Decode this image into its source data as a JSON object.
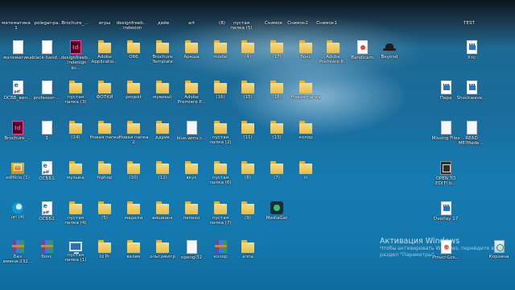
{
  "desktop": {
    "top_row_labels": [
      {
        "label": "математика 1",
        "type": "doc"
      },
      {
        "label": "polegar-pa...",
        "type": "doc"
      },
      {
        "label": "Brochure_...",
        "type": "doc"
      },
      {
        "label": "игры",
        "type": "folder"
      },
      {
        "label": "designfreeb... indesign 2-...",
        "type": "doc"
      },
      {
        "label": "дейв",
        "type": "folder"
      },
      {
        "label": "art",
        "type": "folder"
      },
      {
        "label": "(8)",
        "type": "folder"
      },
      {
        "label": "пустая папка (5)",
        "type": "folder"
      },
      {
        "label": "Снимок",
        "type": "doc"
      },
      {
        "label": "Снимок2",
        "type": "doc"
      },
      {
        "label": "Снимок1",
        "type": "doc"
      },
      {
        "label": "TEST",
        "type": "doc"
      }
    ],
    "icons": [
      {
        "label": "математика",
        "type": "doc"
      },
      {
        "label": "black-hand...",
        "type": "doc"
      },
      {
        "label": "designfreeb... indesign br...",
        "type": "indesign"
      },
      {
        "label": "Adobe Applicatio...",
        "type": "folder"
      },
      {
        "label": "Об6",
        "type": "folder"
      },
      {
        "label": "Brochure Template",
        "type": "folder"
      },
      {
        "label": "Аркша",
        "type": "folder"
      },
      {
        "label": "model",
        "type": "folder"
      },
      {
        "label": "(4)",
        "type": "folder"
      },
      {
        "label": "(17)",
        "type": "folder"
      },
      {
        "label": "бокс",
        "type": "folder"
      },
      {
        "label": "Adobe Premiere P...",
        "type": "folder"
      },
      {
        "label": "Bandicam",
        "type": "record"
      },
      {
        "label": "Beyond",
        "type": "hat"
      },
      {
        "label": "Хтс",
        "type": "video"
      },
      {
        "label": "ОСББ_вип...",
        "type": "pdf"
      },
      {
        "label": "professor-...",
        "type": "doc"
      },
      {
        "label": "пустая папка (3)",
        "type": "folder"
      },
      {
        "label": "ФОТКИ",
        "type": "folder"
      },
      {
        "label": "projekt",
        "type": "folder"
      },
      {
        "label": "мувики)",
        "type": "folder"
      },
      {
        "label": "Adobe Premiere P...",
        "type": "folder"
      },
      {
        "label": "(16)",
        "type": "folder"
      },
      {
        "label": "(15)",
        "type": "folder"
      },
      {
        "label": "(18)",
        "type": "folder"
      },
      {
        "label": "Новая папка",
        "type": "folder"
      },
      {
        "label": "Пара",
        "type": "video"
      },
      {
        "label": "Shockwave...",
        "type": "video"
      },
      {
        "label": "Brochure_...",
        "type": "indesign"
      },
      {
        "label": "3",
        "type": "doc"
      },
      {
        "label": "(14)",
        "type": "folder"
      },
      {
        "label": "Новая папка",
        "type": "folder"
      },
      {
        "label": "Новая папка 2",
        "type": "folder"
      },
      {
        "label": "ддрик",
        "type": "folder"
      },
      {
        "label": "blue.wmv.c...",
        "type": "blank"
      },
      {
        "label": "пустая папка (2)",
        "type": "folder"
      },
      {
        "label": "(11)",
        "type": "folder"
      },
      {
        "label": "(13)",
        "type": "folder"
      },
      {
        "label": "колор",
        "type": "folder"
      },
      {
        "label": "Missing Files",
        "type": "blank"
      },
      {
        "label": "READ ME!Made ...",
        "type": "blank"
      },
      {
        "label": "edificio (1)",
        "type": "pictures"
      },
      {
        "label": "ОСББ1",
        "type": "pdf"
      },
      {
        "label": "музыка",
        "type": "folder"
      },
      {
        "label": "hiphop",
        "type": "folder"
      },
      {
        "label": "(10)",
        "type": "folder"
      },
      {
        "label": "(12)",
        "type": "folder"
      },
      {
        "label": "вкус",
        "type": "folder"
      },
      {
        "label": "пустая папка (6)",
        "type": "folder"
      },
      {
        "label": "(6)",
        "type": "folder"
      },
      {
        "label": "(7)",
        "type": "folder"
      },
      {
        "label": "ti",
        "type": "folder"
      },
      {
        "label": "OPEN TO EDIT! b...",
        "type": "system"
      },
      {
        "label": "url (4)",
        "type": "edge"
      },
      {
        "label": "ОСББ2",
        "type": "pdf"
      },
      {
        "label": "пустая папка (4)",
        "type": "folder"
      },
      {
        "label": "(5)",
        "type": "folder"
      },
      {
        "label": "мадели",
        "type": "folder"
      },
      {
        "label": "вишванк",
        "type": "folder"
      },
      {
        "label": "пепехо",
        "type": "folder"
      },
      {
        "label": "пустая папка (7)",
        "type": "folder"
      },
      {
        "label": "(9)",
        "type": "folder"
      },
      {
        "label": "MediaGet",
        "type": "app"
      },
      {
        "label": "Overlay 17",
        "type": "video"
      },
      {
        "label": "Без имени-232...",
        "type": "archive"
      },
      {
        "label": "бокс",
        "type": "archive"
      },
      {
        "label": "пустая папка (1)",
        "type": "computer"
      },
      {
        "label": "Id Pr",
        "type": "folder"
      },
      {
        "label": "велик",
        "type": "folder"
      },
      {
        "label": "ольгдмитр",
        "type": "folder"
      },
      {
        "label": "opengl32",
        "type": "blank"
      },
      {
        "label": "колор",
        "type": "archive"
      },
      {
        "label": "anna",
        "type": "folder"
      },
      {
        "label": "Prnscr-Los...",
        "type": "record"
      },
      {
        "label": "Корзина",
        "type": "recycle"
      }
    ]
  },
  "watermark": {
    "title": "Активация Windows",
    "line1": "Чтобы активировать Windows, перейдите в",
    "line2": "раздел \"Параметры\"."
  }
}
